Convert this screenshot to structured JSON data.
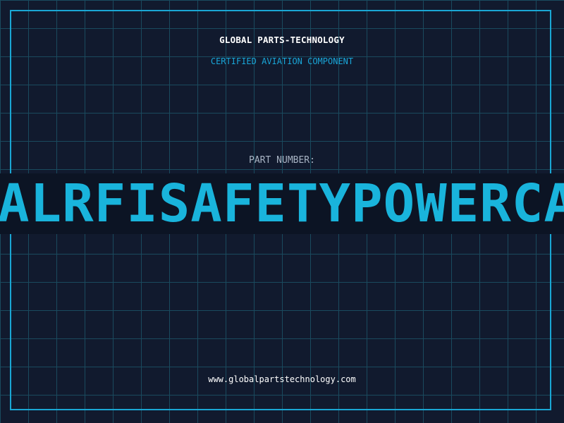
{
  "header": {
    "company": "GLOBAL PARTS-TECHNOLOGY",
    "tagline": "CERTIFIED AVIATION COMPONENT"
  },
  "part": {
    "label": "PART NUMBER:",
    "number": "ALRFISAFETYPOWERCA"
  },
  "footer": {
    "website": "www.globalpartstechnology.com"
  },
  "colors": {
    "background": "#111a2e",
    "grid": "#1a4a5e",
    "accent": "#19b4dc",
    "band": "#0c1424"
  }
}
